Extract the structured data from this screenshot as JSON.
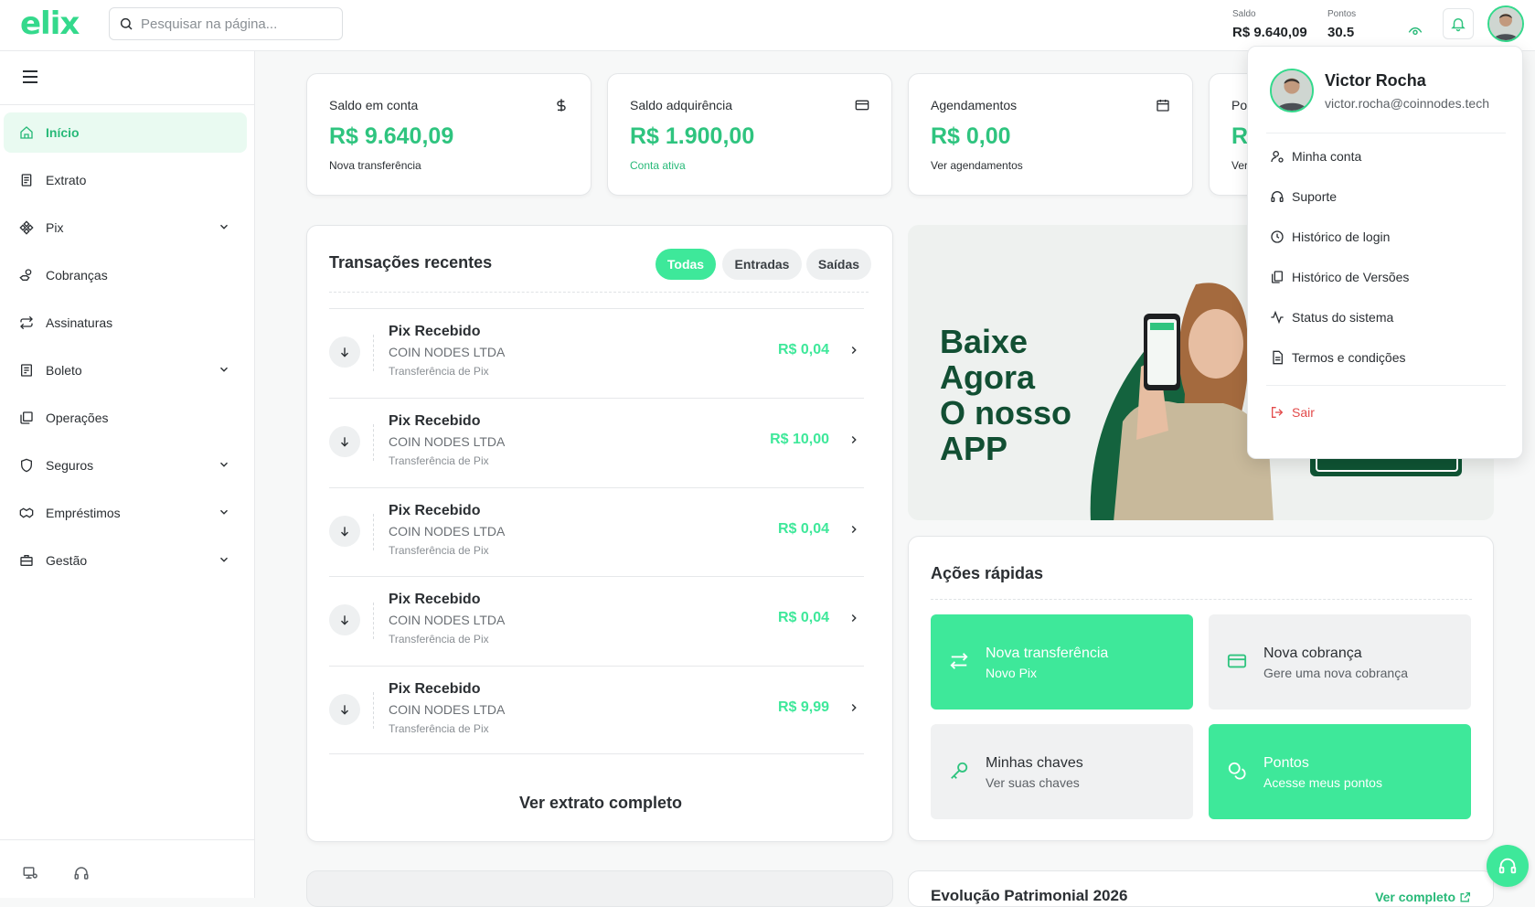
{
  "app": {
    "logo": "elix"
  },
  "search": {
    "placeholder": "Pesquisar na página..."
  },
  "header": {
    "saldo_label": "Saldo",
    "saldo_value": "R$ 9.640,09",
    "pontos_label": "Pontos",
    "pontos_value": "30.5"
  },
  "sidebar": {
    "items": [
      {
        "label": "Início",
        "icon": "home-icon",
        "active": true,
        "expandable": false
      },
      {
        "label": "Extrato",
        "icon": "receipt-icon",
        "active": false,
        "expandable": false
      },
      {
        "label": "Pix",
        "icon": "pix-icon",
        "active": false,
        "expandable": true
      },
      {
        "label": "Cobranças",
        "icon": "hand-coins-icon",
        "active": false,
        "expandable": false
      },
      {
        "label": "Assinaturas",
        "icon": "repeat-icon",
        "active": false,
        "expandable": false
      },
      {
        "label": "Boleto",
        "icon": "file-text-icon",
        "active": false,
        "expandable": true
      },
      {
        "label": "Operações",
        "icon": "layers-icon",
        "active": false,
        "expandable": false
      },
      {
        "label": "Seguros",
        "icon": "shield-icon",
        "active": false,
        "expandable": true
      },
      {
        "label": "Empréstimos",
        "icon": "handshake-icon",
        "active": false,
        "expandable": true
      },
      {
        "label": "Gestão",
        "icon": "briefcase-icon",
        "active": false,
        "expandable": true
      }
    ]
  },
  "stats": [
    {
      "title": "Saldo em conta",
      "value": "R$ 9.640,09",
      "sub": "Nova transferência",
      "icon": "dollar-icon"
    },
    {
      "title": "Saldo adquirência",
      "value": "R$ 1.900,00",
      "sub": "Conta ativa",
      "icon": "credit-card-icon"
    },
    {
      "title": "Agendamentos",
      "value": "R$ 0,00",
      "sub": "Ver agendamentos",
      "icon": "calendar-icon"
    },
    {
      "title": "Po",
      "value": "R",
      "sub": "Ver"
    }
  ],
  "transactions": {
    "title": "Transações recentes",
    "filters": [
      "Todas",
      "Entradas",
      "Saídas"
    ],
    "rows": [
      {
        "name": "Pix Recebido",
        "company": "COIN NODES LTDA",
        "type": "Transferência de Pix",
        "amount": "R$ 0,04"
      },
      {
        "name": "Pix Recebido",
        "company": "COIN NODES LTDA",
        "type": "Transferência de Pix",
        "amount": "R$ 10,00"
      },
      {
        "name": "Pix Recebido",
        "company": "COIN NODES LTDA",
        "type": "Transferência de Pix",
        "amount": "R$ 0,04"
      },
      {
        "name": "Pix Recebido",
        "company": "COIN NODES LTDA",
        "type": "Transferência de Pix",
        "amount": "R$ 0,04"
      },
      {
        "name": "Pix Recebido",
        "company": "COIN NODES LTDA",
        "type": "Transferência de Pix",
        "amount": "R$ 9,99"
      }
    ],
    "more": "Ver extrato completo"
  },
  "banner": {
    "line1": "Baixe",
    "line2": "Agora",
    "line3": "O nosso",
    "line4": "APP"
  },
  "quick_actions": {
    "title": "Ações rápidas",
    "tiles": [
      {
        "title": "Nova transferência",
        "sub": "Novo Pix",
        "icon": "arrows-swap-icon"
      },
      {
        "title": "Nova cobrança",
        "sub": "Gere uma nova cobrança",
        "icon": "credit-card-icon"
      },
      {
        "title": "Minhas chaves",
        "sub": "Ver suas chaves",
        "icon": "key-icon"
      },
      {
        "title": "Pontos",
        "sub": "Acesse meus pontos",
        "icon": "coins-icon"
      }
    ]
  },
  "evolution": {
    "title": "Evolução Patrimonial 2026",
    "link": "Ver completo"
  },
  "user_menu": {
    "name": "Victor Rocha",
    "email": "victor.rocha@coinnodes.tech",
    "items": [
      {
        "label": "Minha conta",
        "icon": "user-icon"
      },
      {
        "label": "Suporte",
        "icon": "headset-icon"
      },
      {
        "label": "Histórico de login",
        "icon": "clock-icon"
      },
      {
        "label": "Histórico de Versões",
        "icon": "copy-icon"
      },
      {
        "label": "Status do sistema",
        "icon": "activity-icon"
      },
      {
        "label": "Termos e condições",
        "icon": "document-icon"
      }
    ],
    "logout": "Sair"
  },
  "colors": {
    "brand": "#34d98c",
    "accent": "#3ee89a",
    "danger": "#e34b4b",
    "banner_text": "#124f33"
  }
}
